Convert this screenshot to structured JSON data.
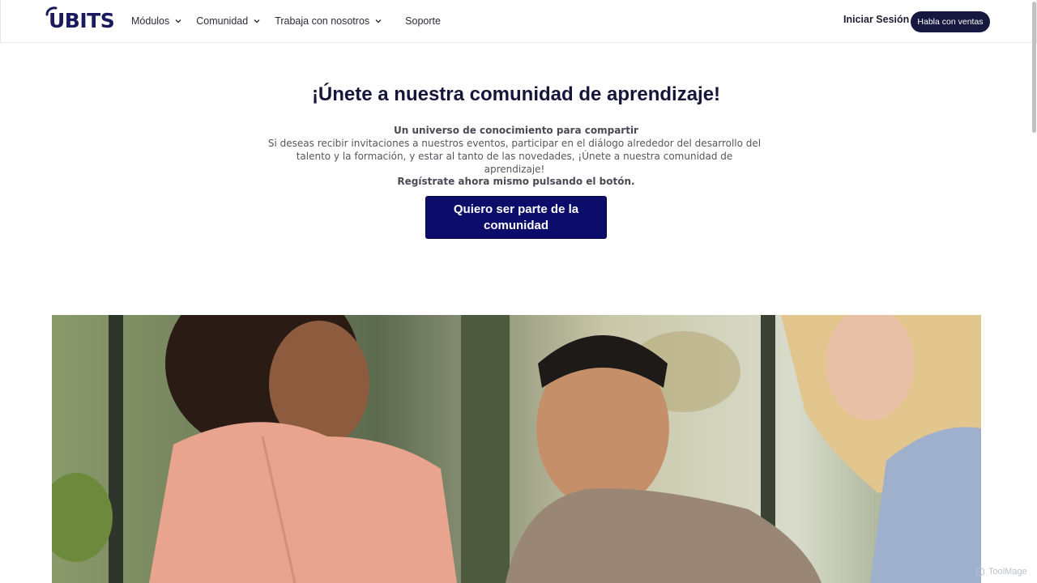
{
  "header": {
    "logo_text": "UBITS",
    "nav": [
      {
        "label": "Módulos",
        "has_dropdown": true
      },
      {
        "label": "Comunidad",
        "has_dropdown": true
      },
      {
        "label": "Trabaja con nosotros",
        "has_dropdown": true
      },
      {
        "label": "Soporte",
        "has_dropdown": false
      }
    ],
    "login_label": "Iniciar Sesión",
    "sales_button_label": "Habla con ventas"
  },
  "main": {
    "title": "¡Únete a nuestra comunidad de aprendizaje!",
    "subtitle": "Un universo de conocimiento para compartir",
    "description": "Si deseas recibir invitaciones a nuestros eventos, participar en el diálogo alrededor del desarrollo del talento y la formación, y estar al tanto de las novedades, ¡Únete a nuestra comunidad de aprendizaje!",
    "cta_text": "Regístrate ahora mismo pulsando el botón.",
    "cta_button_label": "Quiero ser parte de la comunidad"
  },
  "watermark": "ToolMage",
  "colors": {
    "brand_navy": "#16183f",
    "cta_blue": "#0c0c6a",
    "logo_blue": "#1a1a5e"
  }
}
